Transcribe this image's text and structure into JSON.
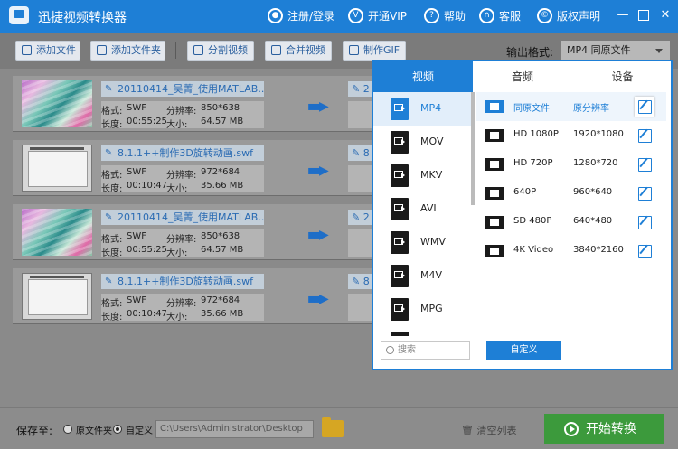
{
  "app": {
    "title": "迅捷视频转换器"
  },
  "header_links": {
    "login": "注册/登录",
    "vip": "开通VIP",
    "help": "帮助",
    "service": "客服",
    "copyright": "版权声明"
  },
  "toolbar": {
    "add_file": "添加文件",
    "add_folder": "添加文件夹",
    "split_video": "分割视频",
    "merge_video": "合并视频",
    "make_gif": "制作GIF",
    "output_format_label": "输出格式:",
    "output_format_value": "MP4  同原文件"
  },
  "files": [
    {
      "name": "20110414_吴菁_使用MATLAB...",
      "format_label": "格式:",
      "format": "SWF",
      "res_label": "分辨率:",
      "resolution": "850*638",
      "dur_label": "长度:",
      "duration": "00:55:25",
      "size_label": "大小:",
      "size": "64.57 MB",
      "out_prefix": "2"
    },
    {
      "name": "8.1.1++制作3D旋转动画.swf",
      "format_label": "格式:",
      "format": "SWF",
      "res_label": "分辨率:",
      "resolution": "972*684",
      "dur_label": "长度:",
      "duration": "00:10:47",
      "size_label": "大小:",
      "size": "35.66 MB",
      "out_prefix": "8"
    },
    {
      "name": "20110414_吴菁_使用MATLAB...",
      "format_label": "格式:",
      "format": "SWF",
      "res_label": "分辨率:",
      "resolution": "850*638",
      "dur_label": "长度:",
      "duration": "00:55:25",
      "size_label": "大小:",
      "size": "64.57 MB",
      "out_prefix": "2"
    },
    {
      "name": "8.1.1++制作3D旋转动画.swf",
      "format_label": "格式:",
      "format": "SWF",
      "res_label": "分辨率:",
      "resolution": "972*684",
      "dur_label": "长度:",
      "duration": "00:10:47",
      "size_label": "大小:",
      "size": "35.66 MB",
      "out_prefix": "8"
    }
  ],
  "format_panel": {
    "tabs": [
      "视频",
      "音频",
      "设备"
    ],
    "formats": [
      "MP4",
      "MOV",
      "MKV",
      "AVI",
      "WMV",
      "M4V",
      "MPG"
    ],
    "format_icon_labels": [
      "MP4",
      "MOV",
      "MKV",
      "AVI",
      "WMV",
      "M4V",
      "MPEG"
    ],
    "qualities": [
      {
        "name": "同原文件",
        "res": "原分辨率"
      },
      {
        "name": "HD 1080P",
        "res": "1920*1080"
      },
      {
        "name": "HD 720P",
        "res": "1280*720"
      },
      {
        "name": "640P",
        "res": "960*640"
      },
      {
        "name": "SD 480P",
        "res": "640*480"
      },
      {
        "name": "4K Video",
        "res": "3840*2160"
      }
    ],
    "search_placeholder": "搜索",
    "custom_label": "自定义"
  },
  "bottom": {
    "save_to_label": "保存至:",
    "option_original": "原文件夹",
    "option_custom": "自定义",
    "path": "C:\\Users\\Administrator\\Desktop",
    "clear_list": "清空列表",
    "start": "开始转换"
  },
  "colors": {
    "accent": "#1e7fd6",
    "start_green": "#3c9a3c"
  }
}
